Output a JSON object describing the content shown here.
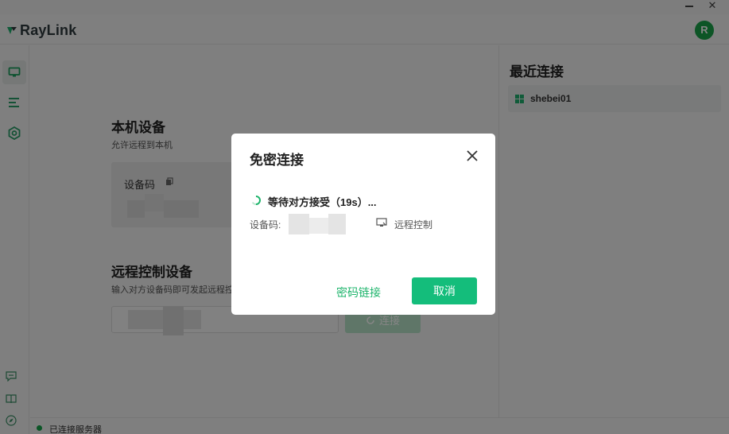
{
  "app": {
    "name": "RayLink",
    "avatar_initial": "R",
    "accent": "#14bd7b"
  },
  "window": {
    "minimize": "—",
    "close": "✕"
  },
  "sidebar": {
    "items": [
      {
        "icon": "monitor-icon",
        "active": true
      },
      {
        "icon": "list-icon",
        "active": false
      },
      {
        "icon": "settings-hex-icon",
        "active": false
      }
    ],
    "bottom": [
      "message-icon",
      "book-icon",
      "compass-icon"
    ]
  },
  "local_device": {
    "title": "本机设备",
    "subtitle": "允许远程到本机",
    "code_label": "设备码"
  },
  "remote_device": {
    "title": "远程控制设备",
    "subtitle": "输入对方设备码即可发起远程控",
    "connect_label": "连接"
  },
  "recent": {
    "title": "最近连接",
    "items": [
      {
        "name": "shebei01",
        "os_icon": "windows-icon"
      }
    ]
  },
  "status": {
    "text": "已连接服务器",
    "color": "#16a34a"
  },
  "dialog": {
    "title": "免密连接",
    "waiting_text": "等待对方接受（19s）...",
    "code_label": "设备码: ",
    "mode_label": "远程控制",
    "password_link": "密码链接",
    "cancel_label": "取消"
  }
}
